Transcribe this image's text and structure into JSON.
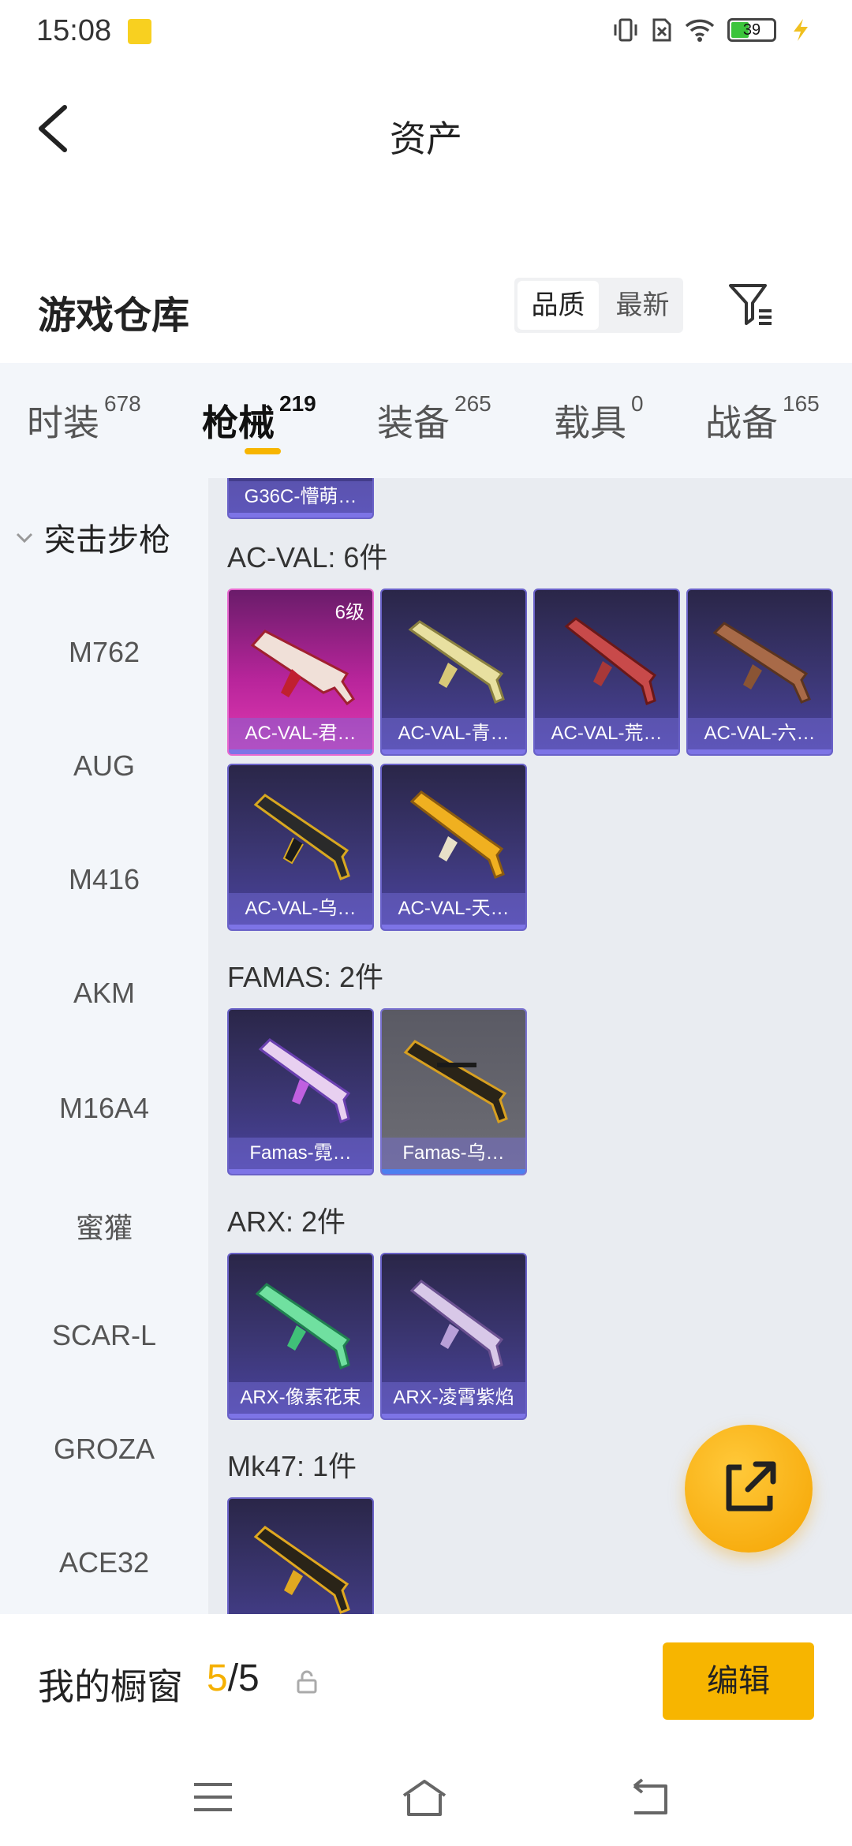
{
  "status_bar": {
    "time": "15:08",
    "battery": "39"
  },
  "header": {
    "title": "资产"
  },
  "warehouse": {
    "title": "游戏仓库",
    "sort_options": [
      "品质",
      "最新"
    ]
  },
  "tabs": [
    {
      "label": "时装",
      "count": "678"
    },
    {
      "label": "枪械",
      "count": "219"
    },
    {
      "label": "装备",
      "count": "265"
    },
    {
      "label": "载具",
      "count": "0"
    },
    {
      "label": "战备",
      "count": "165"
    }
  ],
  "sidebar": {
    "section": "突击步枪",
    "items": [
      "M762",
      "AUG",
      "M416",
      "AKM",
      "M16A4",
      "蜜獾",
      "SCAR-L",
      "GROZA",
      "ACE32"
    ]
  },
  "content": {
    "partial_card": "G36C-懵萌…",
    "groups": [
      {
        "title": "AC-VAL: 6件",
        "cards": [
          "AC-VAL-君…",
          "AC-VAL-青…",
          "AC-VAL-荒…",
          "AC-VAL-六…",
          "AC-VAL-乌…",
          "AC-VAL-天…"
        ],
        "level": "6级"
      },
      {
        "title": "FAMAS: 2件",
        "cards": [
          "Famas-霓…",
          "Famas-乌…"
        ]
      },
      {
        "title": "ARX: 2件",
        "cards": [
          "ARX-像素花束",
          "ARX-凌霄紫焰"
        ]
      },
      {
        "title": "Mk47: 1件",
        "cards": [
          ""
        ]
      }
    ]
  },
  "bottom": {
    "window_label": "我的橱窗",
    "window_current": "5",
    "window_total": "/5",
    "edit_label": "编辑"
  }
}
